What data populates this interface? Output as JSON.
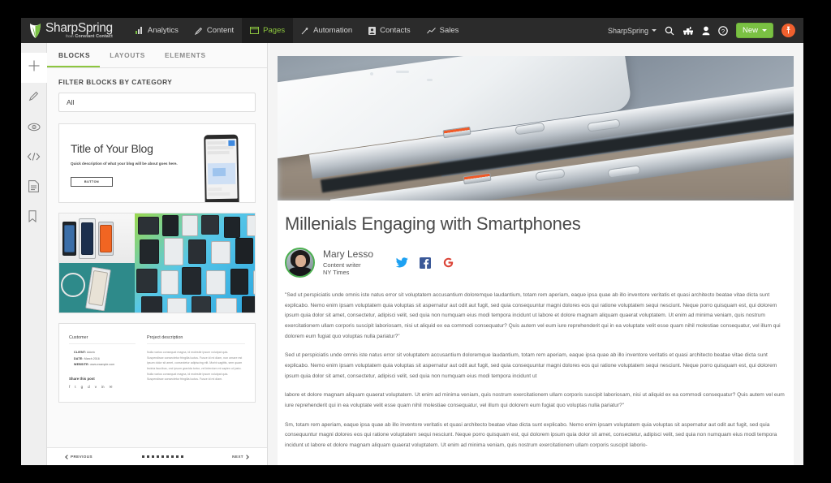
{
  "app": {
    "brand_name": "SharpSpring",
    "brand_tagline_prefix": "from",
    "brand_tagline": "Constant Contact",
    "accent_green": "#8dc63f",
    "button_green": "#7ac143",
    "avatar_orange": "#f0602e",
    "topbar_bg": "#2b2b2b"
  },
  "nav": {
    "items": [
      {
        "label": "Analytics",
        "icon": "bar-chart-icon",
        "active": false
      },
      {
        "label": "Content",
        "icon": "pencil-icon",
        "active": false
      },
      {
        "label": "Pages",
        "icon": "window-icon",
        "active": true
      },
      {
        "label": "Automation",
        "icon": "wand-icon",
        "active": false
      },
      {
        "label": "Contacts",
        "icon": "contact-card-icon",
        "active": false
      },
      {
        "label": "Sales",
        "icon": "trend-line-icon",
        "active": false
      }
    ],
    "account_label": "SharpSpring",
    "right_icons": [
      "search-icon",
      "train-icon",
      "person-icon",
      "help-icon"
    ],
    "new_button_label": "New",
    "avatar_icon": "pushpin-icon"
  },
  "rail": {
    "items": [
      {
        "icon": "plus-icon",
        "name": "add-block",
        "active": true
      },
      {
        "icon": "pencil-icon",
        "name": "edit",
        "active": false
      },
      {
        "icon": "eye-icon",
        "name": "preview",
        "active": false
      },
      {
        "icon": "code-icon",
        "name": "source-code",
        "active": false
      },
      {
        "icon": "document-icon",
        "name": "page-settings",
        "active": false
      },
      {
        "icon": "tag-icon",
        "name": "tags",
        "active": false
      }
    ]
  },
  "panel": {
    "tabs": [
      {
        "label": "BLOCKS",
        "active": true
      },
      {
        "label": "LAYOUTS",
        "active": false
      },
      {
        "label": "ELEMENTS",
        "active": false
      }
    ],
    "filter_title": "FILTER BLOCKS BY CATEGORY",
    "filter_value": "All",
    "blocks": [
      {
        "name": "blog-title-block",
        "title": "Title of Your Blog",
        "description": "Quick description of what your blog will be about goes here.",
        "button_label": "BUTTON"
      },
      {
        "name": "image-gallery-block"
      },
      {
        "name": "project-details-block",
        "col_left_heading": "Customer",
        "col_right_heading": "Project description",
        "meta": [
          {
            "label": "CLIENT:",
            "value": "Adoric"
          },
          {
            "label": "DATE:",
            "value": "March 2016"
          },
          {
            "label": "WEBSITE:",
            "value": "www.example.com"
          }
        ],
        "body": "Nulla varius consequat magna, id molestie ipsum volutpat quis. Suspendisse consectetur fringilla luctus. Fusce id mi diam, non ornare est ipsum dolor sit amet, consectetur adipiscing elit. Morbi sagittis, sem quam lecinia faucibus, orci ipsum gravida tortor, vel interdum mi sapien ut justo. Nulla varius consequat magna, id molestie ipsum volutpat quis. Suspendisse consectetur fringilla luctus. Fusce id mi diam.",
        "share_label": "Share this post",
        "share_icons": [
          "facebook-icon",
          "twitter-icon",
          "googleplus-icon",
          "dribbble-icon",
          "vimeo-icon",
          "linkedin-icon",
          "email-icon"
        ]
      }
    ],
    "pager": {
      "previous_label": "PREVIOUS",
      "next_label": "NEXT",
      "grid_icon": "grid-view-icon"
    }
  },
  "article": {
    "hero_alt": "close-up-of-two-stacked-silver-smartphones",
    "title": "Millenials Engaging with Smartphones",
    "author": {
      "name": "Mary Lesso",
      "role": "Content writer",
      "organization": "NY Times",
      "avatar_alt": "author-portrait"
    },
    "socials": [
      {
        "name": "twitter-icon",
        "color": "#1da1f2"
      },
      {
        "name": "facebook-icon",
        "color": "#3b5998"
      },
      {
        "name": "google-icon",
        "color": "#db4437"
      }
    ],
    "paragraphs": [
      "\"Sed ut perspiciatis unde omnis iste natus error sit voluptatem accusantium doloremque laudantium, totam rem aperiam, eaque ipsa quae ab illo inventore veritatis et quasi architecto beatae vitae dicta sunt explicabo. Nemo enim ipsam voluptatem quia voluptas sit aspernatur aut odit aut fugit, sed quia consequuntur magni dolores eos qui ratione voluptatem sequi nesciunt. Neque porro quisquam est, qui dolorem ipsum quia dolor sit amet, consectetur, adipisci velit, sed quia non numquam eius modi tempora incidunt ut labore et dolore magnam aliquam quaerat voluptatem. Ut enim ad minima veniam, quis nostrum exercitationem ullam corporis suscipit laboriosam, nisi ut aliquid ex ea commodi consequatur? Quis autem vel eum iure reprehenderit qui in ea voluptate velit esse quam nihil molestiae consequatur, vel illum qui dolorem eum fugiat quo voluptas nulla pariatur?\"",
      "Sed ut perspiciatis unde omnis iste natus error sit voluptatem accusantium doloremque laudantium, totam rem aperiam, eaque ipsa quae ab illo inventore veritatis et quasi architecto beatae vitae dicta sunt explicabo. Nemo enim ipsam voluptatem quia voluptas sit aspernatur aut odit aut fugit, sed quia consequuntur magni dolores eos qui ratione voluptatem sequi nesciunt. Neque porro quisquam est, qui dolorem ipsum quia dolor sit amet, consectetur, adipisci velit, sed quia non numquam eius modi tempora incidunt ut",
      "labore et dolore magnam aliquam quaerat voluptatem. Ut enim ad minima veniam, quis nostrum exercitationem ullam corporis suscipit laboriosam, nisi ut aliquid ex ea commodi consequatur? Quis autem vel eum iure reprehenderit qui in ea voluptate velit esse quam nihil molestiae consequatur, vel illum qui dolorem eum fugiat quo voluptas nulla pariatur?\"",
      "Sm, totam rem aperiam, eaque ipsa quae ab illo inventore veritatis et quasi architecto beatae vitae dicta sunt explicabo. Nemo enim ipsam voluptatem quia voluptas sit aspernatur aut odit aut fugit, sed quia consequuntur magni dolores eos qui ratione voluptatem sequi nesciunt. Neque porro quisquam est, qui dolorem ipsum quia dolor sit amet, consectetur, adipisci velit, sed quia non numquam eius modi tempora incidunt ut labore et dolore magnam aliquam quaerat voluptatem. Ut enim ad minima veniam, quis nostrum exercitationem ullam corporis suscipit laborio-"
    ]
  }
}
